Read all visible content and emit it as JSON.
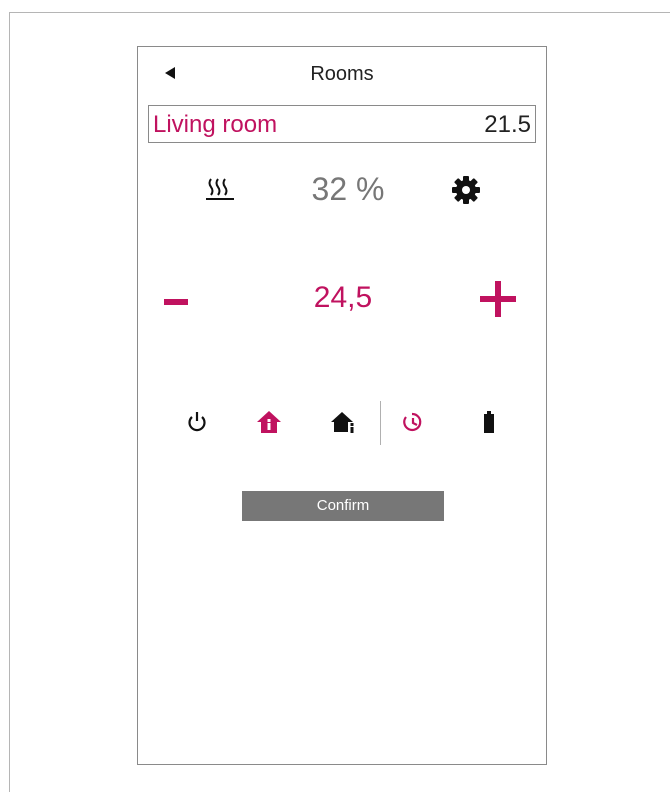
{
  "header": {
    "title": "Rooms"
  },
  "room": {
    "name": "Living room",
    "temperature": "21.5"
  },
  "heating": {
    "percentage": "32 %"
  },
  "setpoint": {
    "value": "24,5"
  },
  "controls": {
    "minus_label": "-",
    "plus_label": "+",
    "modes": [
      "power",
      "home-comfort",
      "home-info",
      "timer",
      "battery"
    ],
    "active_mode": "home-comfort"
  },
  "actions": {
    "confirm_label": "Confirm"
  },
  "colors": {
    "accent": "#c0125f",
    "muted": "#777777",
    "text": "#222222"
  }
}
